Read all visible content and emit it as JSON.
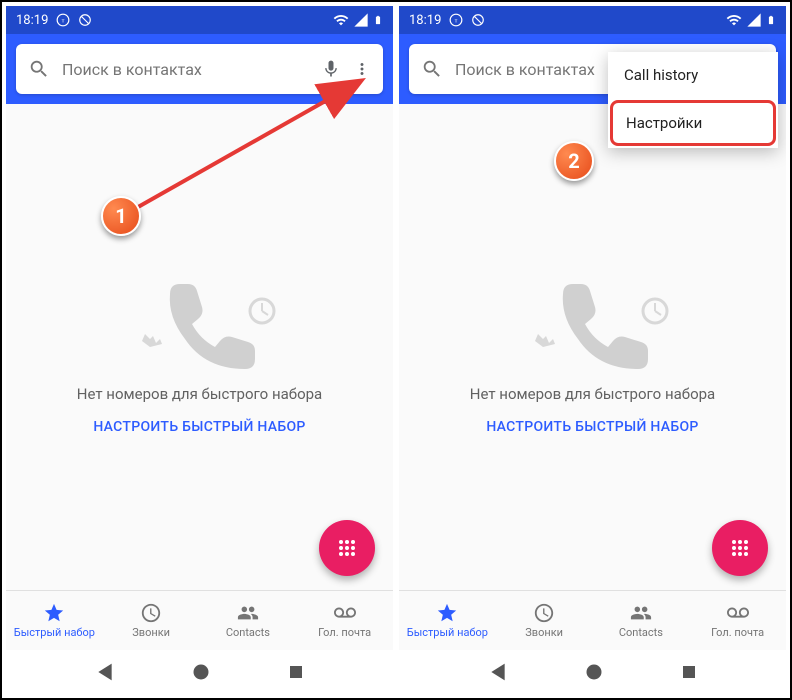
{
  "status": {
    "time": "18:19",
    "icons": [
      "tts-icon",
      "block-icon"
    ]
  },
  "search": {
    "placeholder": "Поиск в контактах"
  },
  "empty": {
    "message": "Нет номеров для быстрого набора",
    "action": "НАСТРОИТЬ БЫСТРЫЙ НАБОР"
  },
  "tabs": [
    {
      "label": "Быстрый набор",
      "icon": "star"
    },
    {
      "label": "Звонки",
      "icon": "history"
    },
    {
      "label": "Contacts",
      "icon": "people"
    },
    {
      "label": "Гол. почта",
      "icon": "voicemail"
    }
  ],
  "dropdown": {
    "item1": "Call history",
    "item2": "Настройки"
  },
  "badges": {
    "one": "1",
    "two": "2"
  }
}
